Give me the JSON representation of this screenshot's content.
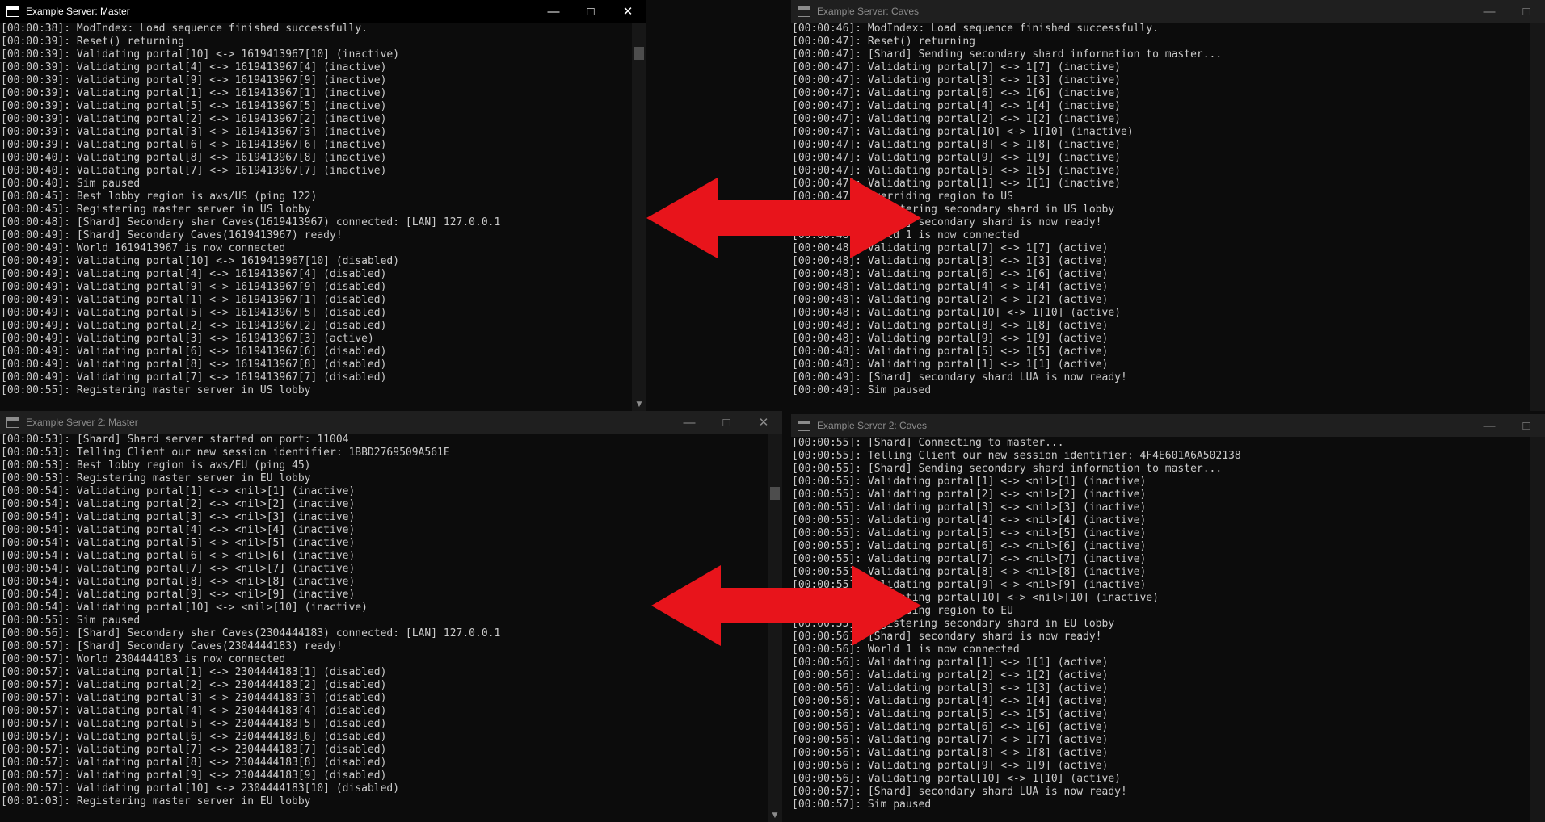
{
  "windows": [
    {
      "id": "tl",
      "title": "Example Server: Master",
      "active": true,
      "lines": [
        "[00:00:38]: ModIndex: Load sequence finished successfully.",
        "[00:00:39]: Reset() returning",
        "[00:00:39]: Validating portal[10] <-> 1619413967[10] (inactive)",
        "[00:00:39]: Validating portal[4] <-> 1619413967[4] (inactive)",
        "[00:00:39]: Validating portal[9] <-> 1619413967[9] (inactive)",
        "[00:00:39]: Validating portal[1] <-> 1619413967[1] (inactive)",
        "[00:00:39]: Validating portal[5] <-> 1619413967[5] (inactive)",
        "[00:00:39]: Validating portal[2] <-> 1619413967[2] (inactive)",
        "[00:00:39]: Validating portal[3] <-> 1619413967[3] (inactive)",
        "[00:00:39]: Validating portal[6] <-> 1619413967[6] (inactive)",
        "[00:00:40]: Validating portal[8] <-> 1619413967[8] (inactive)",
        "[00:00:40]: Validating portal[7] <-> 1619413967[7] (inactive)",
        "[00:00:40]: Sim paused",
        "[00:00:45]: Best lobby region is aws/US (ping 122)",
        "[00:00:45]: Registering master server in US lobby",
        "[00:00:48]: [Shard] Secondary shar Caves(1619413967) connected: [LAN] 127.0.0.1",
        "[00:00:49]: [Shard] Secondary Caves(1619413967) ready!",
        "[00:00:49]: World 1619413967 is now connected",
        "[00:00:49]: Validating portal[10] <-> 1619413967[10] (disabled)",
        "[00:00:49]: Validating portal[4] <-> 1619413967[4] (disabled)",
        "[00:00:49]: Validating portal[9] <-> 1619413967[9] (disabled)",
        "[00:00:49]: Validating portal[1] <-> 1619413967[1] (disabled)",
        "[00:00:49]: Validating portal[5] <-> 1619413967[5] (disabled)",
        "[00:00:49]: Validating portal[2] <-> 1619413967[2] (disabled)",
        "[00:00:49]: Validating portal[3] <-> 1619413967[3] (active)",
        "[00:00:49]: Validating portal[6] <-> 1619413967[6] (disabled)",
        "[00:00:49]: Validating portal[8] <-> 1619413967[8] (disabled)",
        "[00:00:49]: Validating portal[7] <-> 1619413967[7] (disabled)",
        "[00:00:55]: Registering master server in US lobby"
      ]
    },
    {
      "id": "tr",
      "title": "Example Server: Caves",
      "active": false,
      "lines": [
        "[00:00:46]: ModIndex: Load sequence finished successfully.",
        "[00:00:47]: Reset() returning",
        "[00:00:47]: [Shard] Sending secondary shard information to master...",
        "[00:00:47]: Validating portal[7] <-> 1[7] (inactive)",
        "[00:00:47]: Validating portal[3] <-> 1[3] (inactive)",
        "[00:00:47]: Validating portal[6] <-> 1[6] (inactive)",
        "[00:00:47]: Validating portal[4] <-> 1[4] (inactive)",
        "[00:00:47]: Validating portal[2] <-> 1[2] (inactive)",
        "[00:00:47]: Validating portal[10] <-> 1[10] (inactive)",
        "[00:00:47]: Validating portal[8] <-> 1[8] (inactive)",
        "[00:00:47]: Validating portal[9] <-> 1[9] (inactive)",
        "[00:00:47]: Validating portal[5] <-> 1[5] (inactive)",
        "[00:00:47]: Validating portal[1] <-> 1[1] (inactive)",
        "[00:00:47]: Overriding region to US",
        "[00:00:47]: Registering secondary shard in US lobby",
        "[00:00:47]: [Shard] secondary shard is now ready!",
        "[00:00:48]: World 1 is now connected",
        "[00:00:48]: Validating portal[7] <-> 1[7] (active)",
        "[00:00:48]: Validating portal[3] <-> 1[3] (active)",
        "[00:00:48]: Validating portal[6] <-> 1[6] (active)",
        "[00:00:48]: Validating portal[4] <-> 1[4] (active)",
        "[00:00:48]: Validating portal[2] <-> 1[2] (active)",
        "[00:00:48]: Validating portal[10] <-> 1[10] (active)",
        "[00:00:48]: Validating portal[8] <-> 1[8] (active)",
        "[00:00:48]: Validating portal[9] <-> 1[9] (active)",
        "[00:00:48]: Validating portal[5] <-> 1[5] (active)",
        "[00:00:48]: Validating portal[1] <-> 1[1] (active)",
        "[00:00:49]: [Shard] secondary shard LUA is now ready!",
        "[00:00:49]: Sim paused"
      ]
    },
    {
      "id": "bl",
      "title": "Example Server 2: Master",
      "active": false,
      "lines": [
        "[00:00:53]: [Shard] Shard server started on port: 11004",
        "[00:00:53]: Telling Client our new session identifier: 1BBD2769509A561E",
        "[00:00:53]: Best lobby region is aws/EU (ping 45)",
        "[00:00:53]: Registering master server in EU lobby",
        "[00:00:54]: Validating portal[1] <-> <nil>[1] (inactive)",
        "[00:00:54]: Validating portal[2] <-> <nil>[2] (inactive)",
        "[00:00:54]: Validating portal[3] <-> <nil>[3] (inactive)",
        "[00:00:54]: Validating portal[4] <-> <nil>[4] (inactive)",
        "[00:00:54]: Validating portal[5] <-> <nil>[5] (inactive)",
        "[00:00:54]: Validating portal[6] <-> <nil>[6] (inactive)",
        "[00:00:54]: Validating portal[7] <-> <nil>[7] (inactive)",
        "[00:00:54]: Validating portal[8] <-> <nil>[8] (inactive)",
        "[00:00:54]: Validating portal[9] <-> <nil>[9] (inactive)",
        "[00:00:54]: Validating portal[10] <-> <nil>[10] (inactive)",
        "[00:00:55]: Sim paused",
        "[00:00:56]: [Shard] Secondary shar Caves(2304444183) connected: [LAN] 127.0.0.1",
        "[00:00:57]: [Shard] Secondary Caves(2304444183) ready!",
        "[00:00:57]: World 2304444183 is now connected",
        "[00:00:57]: Validating portal[1] <-> 2304444183[1] (disabled)",
        "[00:00:57]: Validating portal[2] <-> 2304444183[2] (disabled)",
        "[00:00:57]: Validating portal[3] <-> 2304444183[3] (disabled)",
        "[00:00:57]: Validating portal[4] <-> 2304444183[4] (disabled)",
        "[00:00:57]: Validating portal[5] <-> 2304444183[5] (disabled)",
        "[00:00:57]: Validating portal[6] <-> 2304444183[6] (disabled)",
        "[00:00:57]: Validating portal[7] <-> 2304444183[7] (disabled)",
        "[00:00:57]: Validating portal[8] <-> 2304444183[8] (disabled)",
        "[00:00:57]: Validating portal[9] <-> 2304444183[9] (disabled)",
        "[00:00:57]: Validating portal[10] <-> 2304444183[10] (disabled)",
        "[00:01:03]: Registering master server in EU lobby"
      ]
    },
    {
      "id": "br",
      "title": "Example Server 2: Caves",
      "active": false,
      "lines": [
        "[00:00:55]: [Shard] Connecting to master...",
        "[00:00:55]: Telling Client our new session identifier: 4F4E601A6A502138",
        "[00:00:55]: [Shard] Sending secondary shard information to master...",
        "[00:00:55]: Validating portal[1] <-> <nil>[1] (inactive)",
        "[00:00:55]: Validating portal[2] <-> <nil>[2] (inactive)",
        "[00:00:55]: Validating portal[3] <-> <nil>[3] (inactive)",
        "[00:00:55]: Validating portal[4] <-> <nil>[4] (inactive)",
        "[00:00:55]: Validating portal[5] <-> <nil>[5] (inactive)",
        "[00:00:55]: Validating portal[6] <-> <nil>[6] (inactive)",
        "[00:00:55]: Validating portal[7] <-> <nil>[7] (inactive)",
        "[00:00:55]: Validating portal[8] <-> <nil>[8] (inactive)",
        "[00:00:55]: Validating portal[9] <-> <nil>[9] (inactive)",
        "[00:00:55]: Validating portal[10] <-> <nil>[10] (inactive)",
        "[00:00:55]: Overriding region to EU",
        "[00:00:55]: Registering secondary shard in EU lobby",
        "[00:00:56]: [Shard] secondary shard is now ready!",
        "[00:00:56]: World 1 is now connected",
        "[00:00:56]: Validating portal[1] <-> 1[1] (active)",
        "[00:00:56]: Validating portal[2] <-> 1[2] (active)",
        "[00:00:56]: Validating portal[3] <-> 1[3] (active)",
        "[00:00:56]: Validating portal[4] <-> 1[4] (active)",
        "[00:00:56]: Validating portal[5] <-> 1[5] (active)",
        "[00:00:56]: Validating portal[6] <-> 1[6] (active)",
        "[00:00:56]: Validating portal[7] <-> 1[7] (active)",
        "[00:00:56]: Validating portal[8] <-> 1[8] (active)",
        "[00:00:56]: Validating portal[9] <-> 1[9] (active)",
        "[00:00:56]: Validating portal[10] <-> 1[10] (active)",
        "[00:00:57]: [Shard] secondary shard LUA is now ready!",
        "[00:00:57]: Sim paused"
      ]
    }
  ],
  "icons": {
    "window_icon": "console-icon",
    "minimize": "minimize-icon",
    "maximize": "maximize-icon",
    "close": "close-icon",
    "annotation": "double-arrow-icon"
  },
  "colors": {
    "console_bg": "#0c0c0c",
    "console_text": "#cccccc",
    "arrow": "#e8141b"
  }
}
